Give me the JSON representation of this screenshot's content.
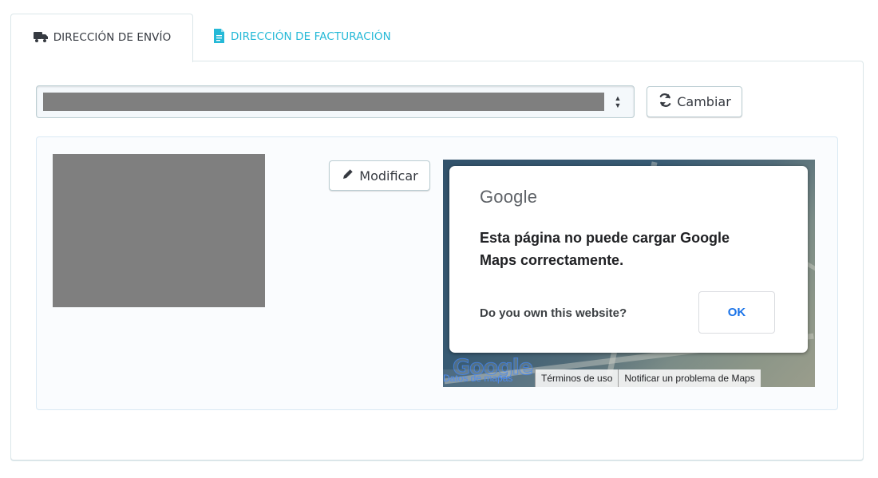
{
  "tabs": {
    "shipping": {
      "label": "DIRECCIÓN DE ENVÍO",
      "icon": "truck-icon",
      "active": true
    },
    "billing": {
      "label": "DIRECCIÓN DE FACTURACIÓN",
      "icon": "document-icon",
      "active": false
    }
  },
  "address_select": {
    "selected_value": "",
    "icon": "select-arrows-icon"
  },
  "buttons": {
    "change": {
      "label": "Cambiar",
      "icon": "refresh-icon"
    },
    "edit": {
      "label": "Modificar",
      "icon": "pencil-icon"
    }
  },
  "map": {
    "dialog": {
      "brand": "Google",
      "message": "Esta página no puede cargar Google Maps correctamente.",
      "question": "Do you own this website?",
      "ok_label": "OK"
    },
    "footer": {
      "data_label": "Datos de mapas",
      "terms_label": "Términos de uso",
      "report_label": "Notificar un problema de Maps"
    },
    "watermark": "Google"
  },
  "colors": {
    "accent": "#25b9d7",
    "text": "#363a41",
    "border": "#dbe6e9",
    "redacted": "#7f7f7f"
  }
}
